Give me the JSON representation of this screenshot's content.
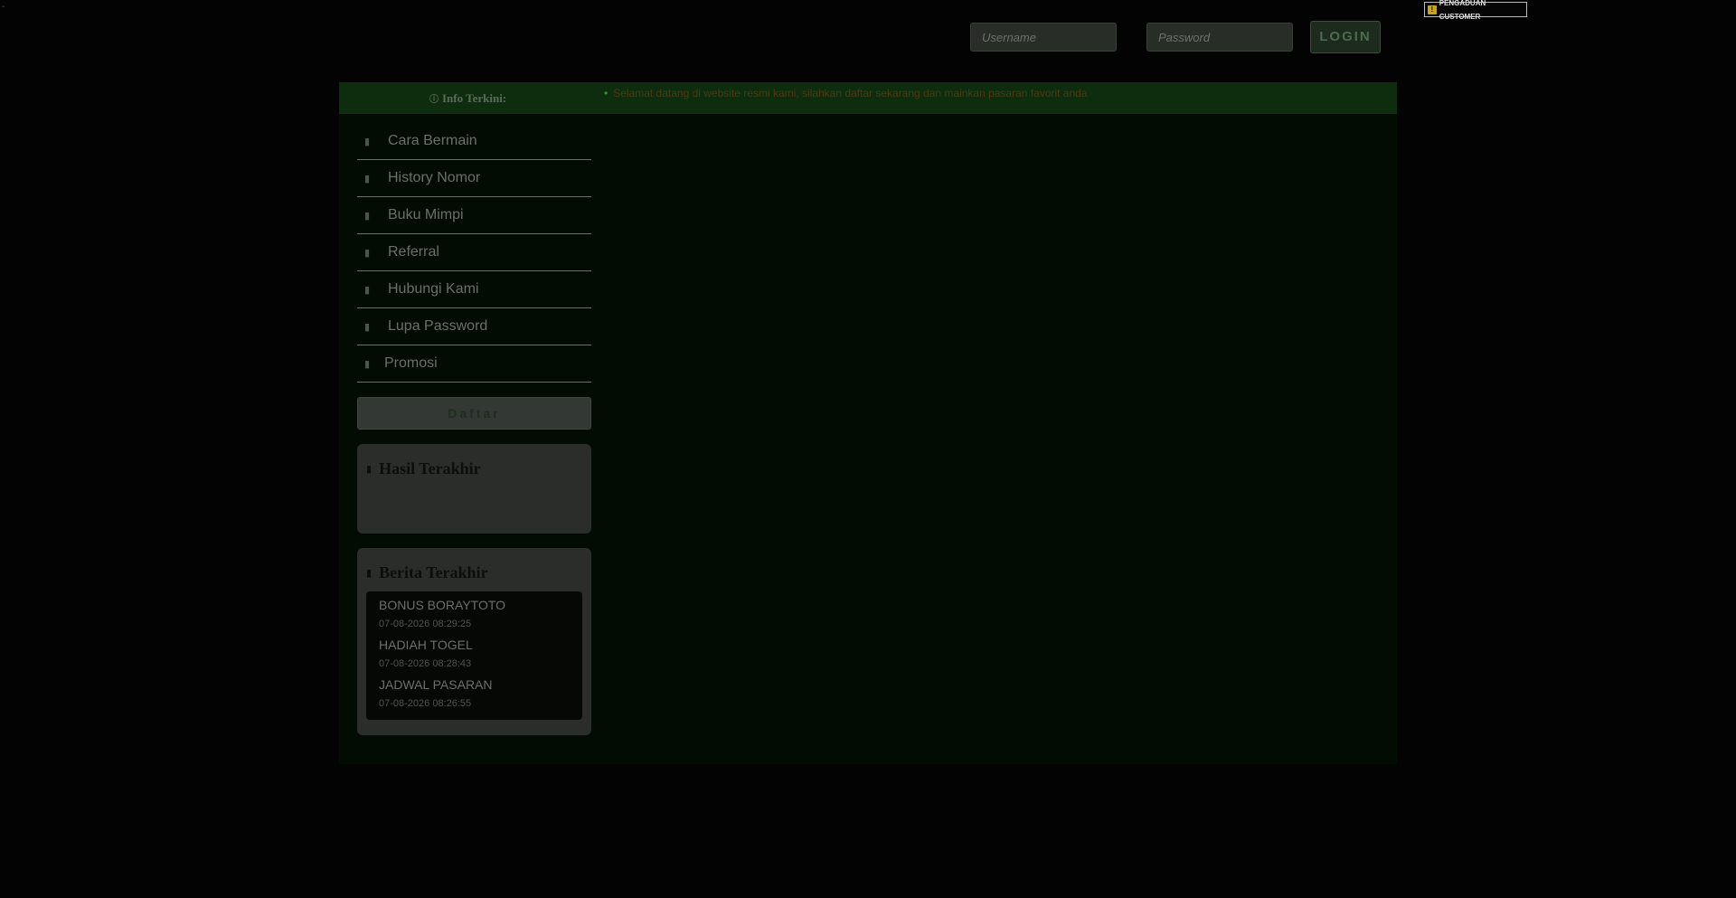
{
  "top": {
    "dash": "-",
    "username_placeholder": "Username",
    "password_placeholder": "Password",
    "login_label": "LOGIN",
    "complaint_label": "PENGADUAN CUSTOMER",
    "complaint_icon": "!"
  },
  "info": {
    "label": "Info Terkini:",
    "icon": "info-icon",
    "ticker": "Selamat datang di website resmi kami, silahkan daftar sekarang dan mainkan pasaran favorit anda"
  },
  "sidebar": {
    "items": [
      {
        "label": "Cara Bermain",
        "icon": "book-icon"
      },
      {
        "label": "History Nomor",
        "icon": "history-icon"
      },
      {
        "label": "Buku Mimpi",
        "icon": "moon-icon"
      },
      {
        "label": "Referral",
        "icon": "users-icon"
      },
      {
        "label": "Hubungi Kami",
        "icon": "phone-icon"
      },
      {
        "label": "Lupa Password",
        "icon": "key-icon"
      },
      {
        "label": "Promosi",
        "icon": "gift-icon"
      }
    ],
    "daftar_label": "Daftar"
  },
  "hasil": {
    "title": "Hasil Terakhir",
    "icon": "trophy-icon"
  },
  "berita": {
    "title": "Berita Terakhir",
    "icon": "newspaper-icon",
    "items": [
      {
        "title": "BONUS BORAYTOTO",
        "date": "07-08-2026 08:29:25"
      },
      {
        "title": "HADIAH TOGEL",
        "date": "07-08-2026 08:28:43"
      },
      {
        "title": "JADWAL PASARAN",
        "date": "07-08-2026 08:26:55"
      }
    ]
  },
  "colors": {
    "background": "#030303",
    "container": "#020c02",
    "info_bar": "#0e2d0e"
  }
}
